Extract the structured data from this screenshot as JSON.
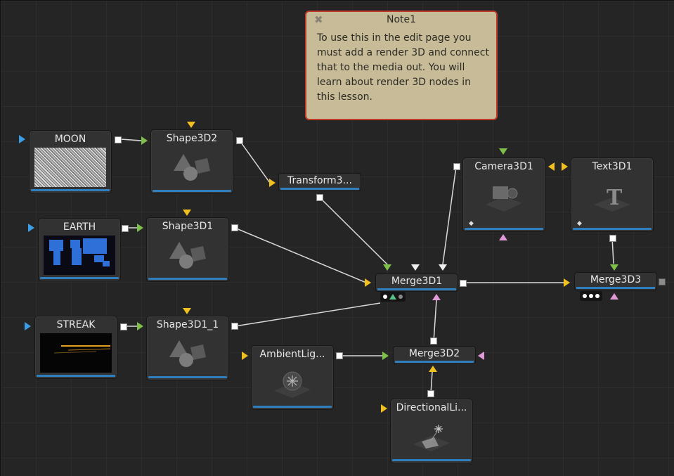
{
  "note": {
    "title": "Note1",
    "body": "To use this in the edit page you must add a render 3D and connect that to the media out. You will learn about render 3D nodes in this lesson."
  },
  "nodes": {
    "moon": "MOON",
    "earth": "EARTH",
    "streak": "STREAK",
    "shape3d2": "Shape3D2",
    "shape3d1": "Shape3D1",
    "shape3d1_1": "Shape3D1_1",
    "transform": "Transform3...",
    "camera": "Camera3D1",
    "text": "Text3D1",
    "merge1": "Merge3D1",
    "merge2": "Merge3D2",
    "merge3": "Merge3D3",
    "ambient": "AmbientLig...",
    "directional": "DirectionalLi..."
  },
  "colors": {
    "canvas": "#252525",
    "node": "#323232",
    "bar": "#2f7fbf",
    "input_yellow": "#f0c020",
    "input_green": "#7ec04a",
    "input_blue": "#3a9ee8",
    "input_pink": "#e19ad8",
    "note_bg": "#c8bc98",
    "note_border": "#c03a2a"
  }
}
